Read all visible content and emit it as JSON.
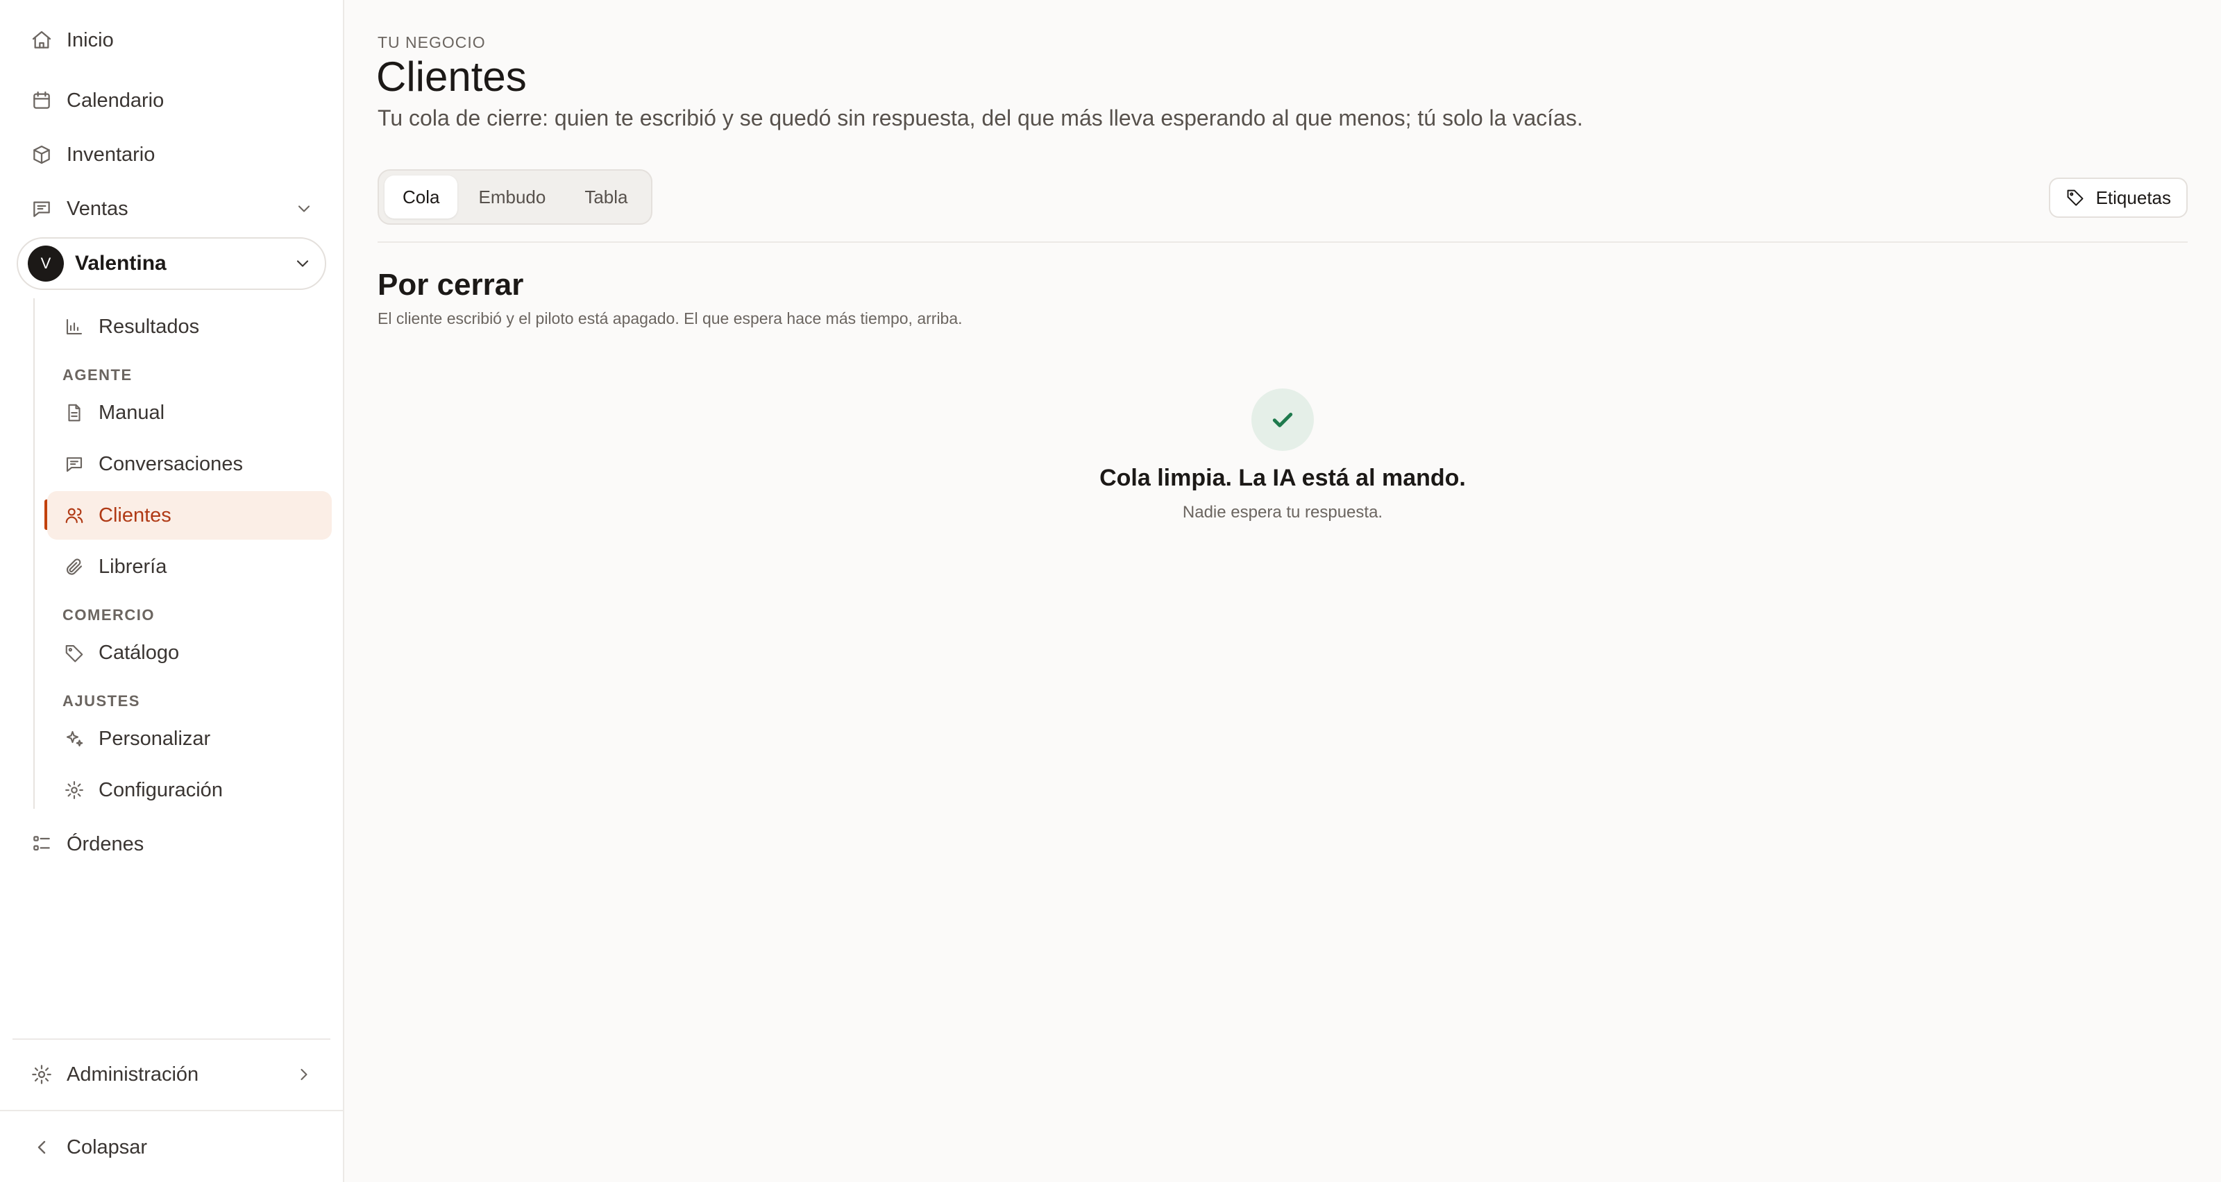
{
  "sidebar": {
    "nav": [
      {
        "label": "Inicio",
        "icon": "home-icon"
      },
      {
        "label": "Calendario",
        "icon": "calendar-icon"
      },
      {
        "label": "Inventario",
        "icon": "box-icon"
      },
      {
        "label": "Ventas",
        "icon": "message-icon"
      }
    ],
    "workspace": {
      "initial": "V",
      "name": "Valentina"
    },
    "results": "Resultados",
    "sections": {
      "agent": "AGENTE",
      "commerce": "COMERCIO",
      "settings": "AJUSTES"
    },
    "agent_items": [
      "Manual",
      "Conversaciones",
      "Clientes",
      "Librería"
    ],
    "commerce_items": [
      "Catálogo"
    ],
    "settings_items": [
      "Personalizar",
      "Configuración"
    ],
    "orders": "Órdenes",
    "admin": "Administración",
    "collapse": "Colapsar",
    "active_item": "Clientes",
    "accent_color": "#c2410c"
  },
  "header": {
    "eyebrow": "TU NEGOCIO",
    "title": "Clientes",
    "subtitle": "Tu cola de cierre: quien te escribió y se quedó sin respuesta, del que más lleva esperando al que menos; tú solo la vacías."
  },
  "tabs": {
    "items": [
      "Cola",
      "Embudo",
      "Tabla"
    ],
    "selected": "Cola"
  },
  "tags_button": "Etiquetas",
  "queue": {
    "title": "Por cerrar",
    "description": "El cliente escribió y el piloto está apagado. El que espera hace más tiempo, arriba.",
    "empty_title": "Cola limpia. La IA está al mando.",
    "empty_subtitle": "Nadie espera tu respuesta."
  }
}
